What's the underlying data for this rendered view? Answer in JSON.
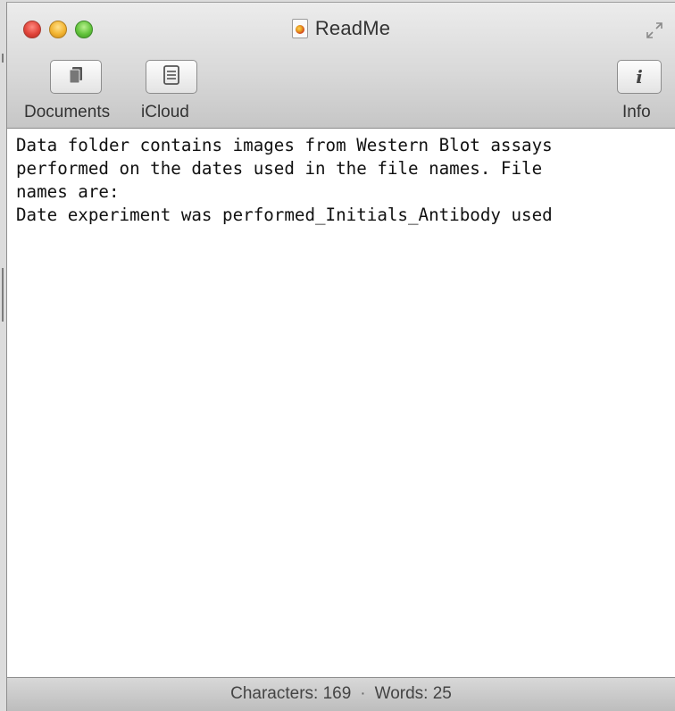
{
  "window": {
    "title": "ReadMe"
  },
  "toolbar": {
    "documents_label": "Documents",
    "icloud_label": "iCloud",
    "info_label": "Info",
    "info_glyph": "i"
  },
  "document": {
    "lines": [
      "Data folder contains images from Western Blot assays",
      "performed on the dates used in the file names. File",
      "names are:",
      "Date experiment was performed_Initials_Antibody used"
    ]
  },
  "status": {
    "characters": "Characters: 169",
    "separator": "·",
    "words": "Words: 25"
  },
  "icons": {
    "close": "close-traffic-light",
    "minimize": "minimize-traffic-light",
    "zoom": "zoom-traffic-light",
    "document": "document-icon",
    "fullscreen": "fullscreen-icon",
    "documents": "documents-icon",
    "icloud": "icloud-icon",
    "info": "info-icon"
  },
  "colors": {
    "close": "#e1453b",
    "minimize": "#f2b431",
    "zoom": "#62c33b",
    "toolbar_top": "#ececec",
    "toolbar_bottom": "#c6c6c6",
    "text": "#111111"
  }
}
